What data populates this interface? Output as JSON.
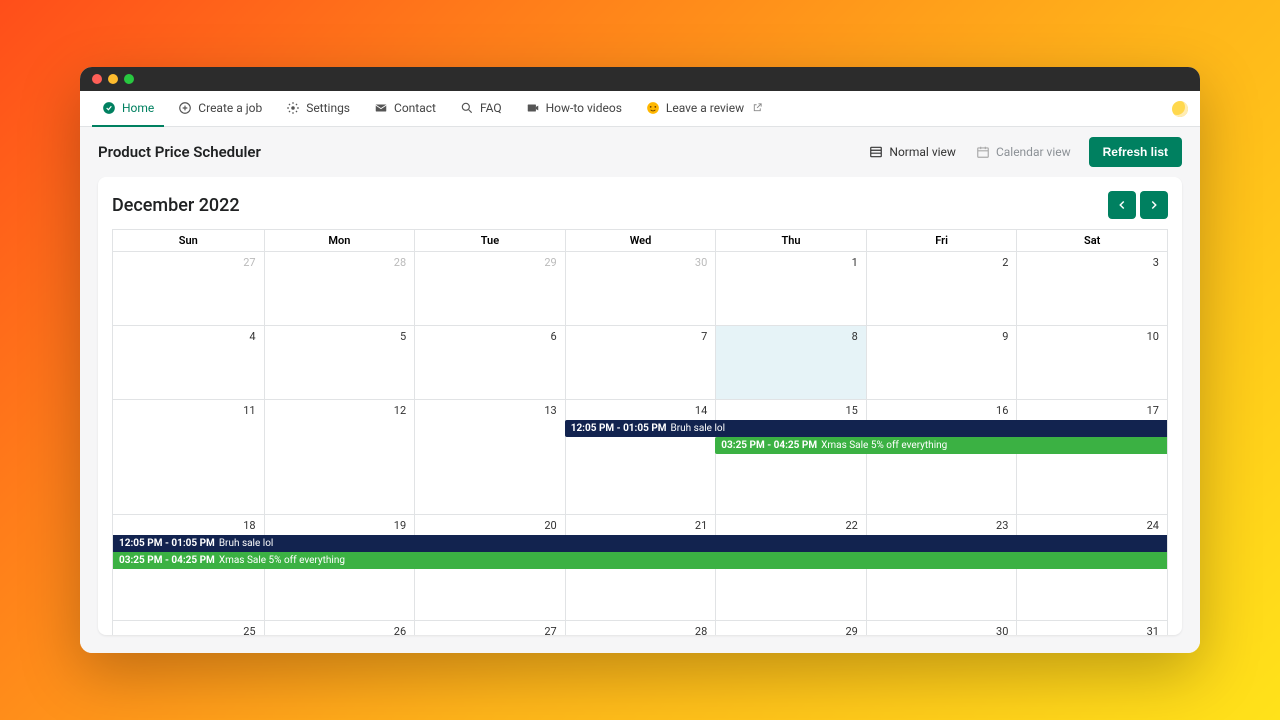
{
  "tabs": {
    "home": "Home",
    "create": "Create a job",
    "settings": "Settings",
    "contact": "Contact",
    "faq": "FAQ",
    "howto": "How-to videos",
    "review": "Leave a review"
  },
  "page": {
    "title": "Product Price Scheduler",
    "normal_view": "Normal view",
    "calendar_view": "Calendar view",
    "refresh": "Refresh list"
  },
  "calendar": {
    "month_label": "December 2022",
    "dow": [
      "Sun",
      "Mon",
      "Tue",
      "Wed",
      "Thu",
      "Fri",
      "Sat"
    ],
    "weeks": [
      {
        "days": [
          {
            "n": "27",
            "other": true
          },
          {
            "n": "28",
            "other": true
          },
          {
            "n": "29",
            "other": true
          },
          {
            "n": "30",
            "other": true
          },
          {
            "n": "1"
          },
          {
            "n": "2"
          },
          {
            "n": "3"
          }
        ]
      },
      {
        "days": [
          {
            "n": "4"
          },
          {
            "n": "5"
          },
          {
            "n": "6"
          },
          {
            "n": "7"
          },
          {
            "n": "8",
            "today": true
          },
          {
            "n": "9"
          },
          {
            "n": "10"
          }
        ]
      },
      {
        "days": [
          {
            "n": "11"
          },
          {
            "n": "12"
          },
          {
            "n": "13"
          },
          {
            "n": "14"
          },
          {
            "n": "15"
          },
          {
            "n": "16"
          },
          {
            "n": "17"
          }
        ]
      },
      {
        "days": [
          {
            "n": "18"
          },
          {
            "n": "19"
          },
          {
            "n": "20"
          },
          {
            "n": "21"
          },
          {
            "n": "22"
          },
          {
            "n": "23"
          },
          {
            "n": "24"
          }
        ]
      },
      {
        "days": [
          {
            "n": "25"
          },
          {
            "n": "26"
          },
          {
            "n": "27"
          },
          {
            "n": "28"
          },
          {
            "n": "29"
          },
          {
            "n": "30"
          },
          {
            "n": "31"
          }
        ]
      }
    ],
    "events": {
      "bruh_time": "12:05 PM - 01:05 PM",
      "bruh_title": "Bruh sale lol",
      "xmas_time": "03:25 PM - 04:25 PM",
      "xmas_title": "Xmas Sale 5% off everything"
    }
  },
  "colors": {
    "accent": "#008060",
    "event_navy": "#12234f",
    "event_green": "#3bb143"
  }
}
